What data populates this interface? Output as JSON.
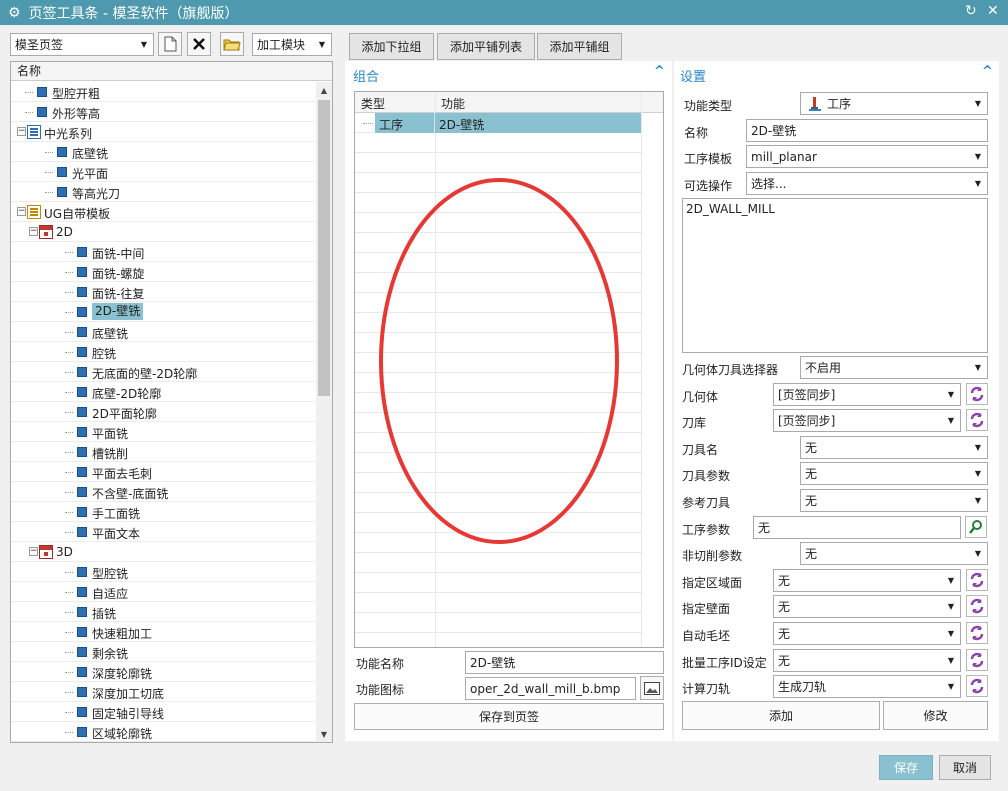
{
  "window": {
    "title": "页签工具条 - 模圣软件（旗舰版）"
  },
  "toolbar": {
    "tab_select": "模圣页签",
    "module_select": "加工模块"
  },
  "tabs": {
    "add_dropdown": "添加下拉组",
    "add_tile_list": "添加平铺列表",
    "add_tile_group": "添加平铺组"
  },
  "tree": {
    "header": "名称",
    "items": [
      {
        "label": "型腔开粗",
        "level": 1,
        "icon": "op-square-icon"
      },
      {
        "label": "外形等高",
        "level": 1,
        "icon": "op-square-icon"
      },
      {
        "label": "中光系列",
        "level": 0,
        "icon": "group-icon",
        "expanded": true
      },
      {
        "label": "底壁铣",
        "level": 2,
        "icon": "op-square-icon"
      },
      {
        "label": "光平面",
        "level": 2,
        "icon": "op-square-icon"
      },
      {
        "label": "等高光刀",
        "level": 2,
        "icon": "op-square-icon"
      },
      {
        "label": "UG自带模板",
        "level": 0,
        "icon": "ug-group-icon",
        "expanded": true
      },
      {
        "label": "2D",
        "level": 1,
        "icon": "calendar-icon",
        "expanded": true
      },
      {
        "label": "面铣-中间",
        "level": 3,
        "icon": "op-square-icon"
      },
      {
        "label": "面铣-螺旋",
        "level": 3,
        "icon": "op-square-icon"
      },
      {
        "label": "面铣-往复",
        "level": 3,
        "icon": "op-square-icon"
      },
      {
        "label": "2D-壁铣",
        "level": 3,
        "icon": "op-square-icon",
        "selected": true
      },
      {
        "label": "底壁铣",
        "level": 3,
        "icon": "op-square-icon"
      },
      {
        "label": "腔铣",
        "level": 3,
        "icon": "op-square-icon"
      },
      {
        "label": "无底面的壁-2D轮廓",
        "level": 3,
        "icon": "op-square-icon"
      },
      {
        "label": "底壁-2D轮廓",
        "level": 3,
        "icon": "op-square-icon"
      },
      {
        "label": "2D平面轮廓",
        "level": 3,
        "icon": "op-square-icon"
      },
      {
        "label": "平面铣",
        "level": 3,
        "icon": "op-square-icon"
      },
      {
        "label": "槽铣削",
        "level": 3,
        "icon": "op-square-icon"
      },
      {
        "label": "平面去毛刺",
        "level": 3,
        "icon": "op-square-icon"
      },
      {
        "label": "不含壁-底面铣",
        "level": 3,
        "icon": "op-square-icon"
      },
      {
        "label": "手工面铣",
        "level": 3,
        "icon": "op-square-icon"
      },
      {
        "label": "平面文本",
        "level": 3,
        "icon": "op-square-icon"
      },
      {
        "label": "3D",
        "level": 1,
        "icon": "calendar-icon",
        "expanded": true
      },
      {
        "label": "型腔铣",
        "level": 3,
        "icon": "op-square-icon"
      },
      {
        "label": "自适应",
        "level": 3,
        "icon": "op-square-icon"
      },
      {
        "label": "插铣",
        "level": 3,
        "icon": "op-square-icon"
      },
      {
        "label": "快速粗加工",
        "level": 3,
        "icon": "op-square-icon"
      },
      {
        "label": "剩余铣",
        "level": 3,
        "icon": "op-square-icon"
      },
      {
        "label": "深度轮廓铣",
        "level": 3,
        "icon": "op-square-icon"
      },
      {
        "label": "深度加工切底",
        "level": 3,
        "icon": "op-square-icon"
      },
      {
        "label": "固定轴引导线",
        "level": 3,
        "icon": "op-square-icon"
      },
      {
        "label": "区域轮廓铣",
        "level": 3,
        "icon": "op-square-icon"
      }
    ]
  },
  "group": {
    "title": "组合",
    "columns": [
      "类型",
      "功能"
    ],
    "rows": [
      {
        "type": "工序",
        "func": "2D-壁铣"
      }
    ],
    "func_name_label": "功能名称",
    "func_name_value": "2D-壁铣",
    "func_icon_label": "功能图标",
    "func_icon_value": "oper_2d_wall_mill_b.bmp",
    "save_button": "保存到页签"
  },
  "settings": {
    "title": "设置",
    "func_type_label": "功能类型",
    "func_type_value": "工序",
    "name_label": "名称",
    "name_value": "2D-壁铣",
    "template_label": "工序模板",
    "template_value": "mill_planar",
    "optional_label": "可选操作",
    "optional_value": "选择...",
    "textarea_value": "2D_WALL_MILL",
    "rows": [
      {
        "label": "几何体刀具选择器",
        "value": "不启用",
        "refresh": false,
        "type": "combo"
      },
      {
        "label": "几何体",
        "value": "[页签同步]",
        "refresh": true,
        "type": "combo"
      },
      {
        "label": "刀库",
        "value": "[页签同步]",
        "refresh": true,
        "type": "combo"
      },
      {
        "label": "刀具名",
        "value": "无",
        "refresh": false,
        "type": "combo"
      },
      {
        "label": "刀具参数",
        "value": "无",
        "refresh": false,
        "type": "combo"
      },
      {
        "label": "参考刀具",
        "value": "无",
        "refresh": false,
        "type": "combo"
      },
      {
        "label": "工序参数",
        "value": "无",
        "refresh": false,
        "type": "search"
      },
      {
        "label": "非切削参数",
        "value": "无",
        "refresh": false,
        "type": "combo"
      },
      {
        "label": "指定区域面",
        "value": "无",
        "refresh": true,
        "type": "combo"
      },
      {
        "label": "指定壁面",
        "value": "无",
        "refresh": true,
        "type": "combo"
      },
      {
        "label": "自动毛坯",
        "value": "无",
        "refresh": true,
        "type": "combo"
      },
      {
        "label": "批量工序ID设定",
        "value": "无",
        "refresh": true,
        "type": "combo"
      },
      {
        "label": "计算刀轨",
        "value": "生成刀轨",
        "refresh": true,
        "type": "combo"
      }
    ],
    "add_button": "添加",
    "modify_button": "修改"
  },
  "footer": {
    "save": "保存",
    "cancel": "取消"
  },
  "colors": {
    "accent": "#4e99ae",
    "selection": "#8ac1d0",
    "section_title": "#2c84c6",
    "annotation": "#e53935"
  }
}
